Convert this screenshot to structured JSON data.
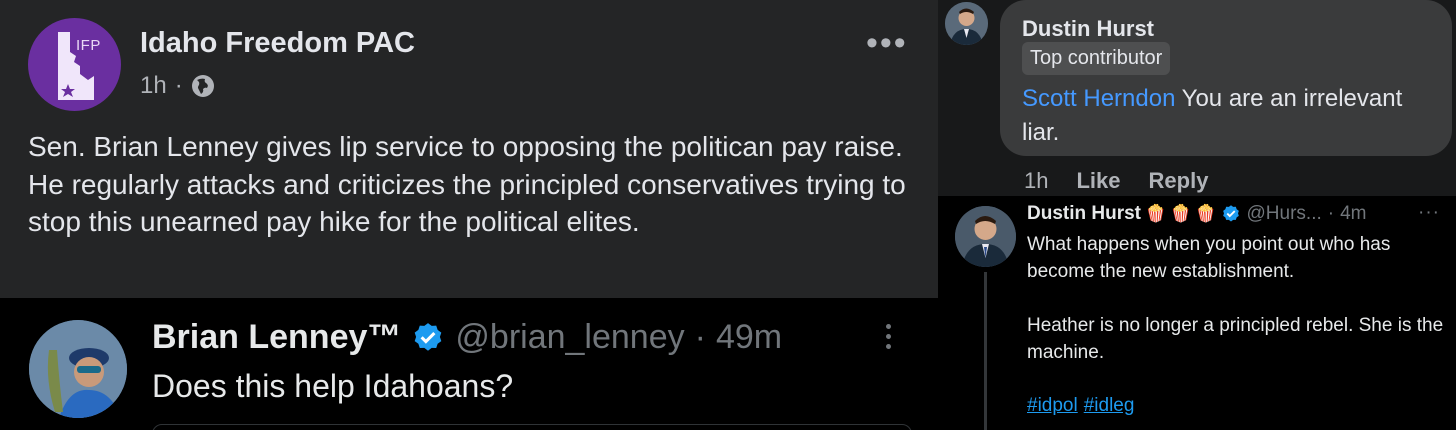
{
  "fb_post": {
    "avatar_text": "IFP",
    "page_name": "Idaho Freedom PAC",
    "time": "1h",
    "separator": "·",
    "more_label": "•••",
    "body": "Sen. Brian Lenney gives lip service to opposing the politican pay raise. He regularly attacks and criticizes the principled conservatives trying to stop this unearned pay hike for the political elites."
  },
  "tweet_lenney": {
    "name": "Brian Lenney™",
    "handle": "@brian_lenney",
    "separator": "·",
    "time": "49m",
    "text": "Does this help Idahoans?",
    "verified_color": "#1d9bf0"
  },
  "fb_comment": {
    "author": "Dustin Hurst",
    "badge": "Top contributor",
    "mention": "Scott Herndon",
    "text": " You are an irrelevant liar.",
    "time": "1h",
    "like_label": "Like",
    "reply_label": "Reply"
  },
  "tweet_hurst": {
    "name": "Dustin Hurst",
    "emojis": [
      "🍿",
      "🍿",
      "🍿"
    ],
    "handle": "@Hurs...",
    "separator": "·",
    "time": "4m",
    "more_label": "···",
    "paragraphs": [
      "What happens when you point out who has become the new establishment.",
      "Heather is no longer a principled rebel. She is the machine."
    ],
    "hashtags": [
      "#idpol",
      "#idleg"
    ]
  }
}
